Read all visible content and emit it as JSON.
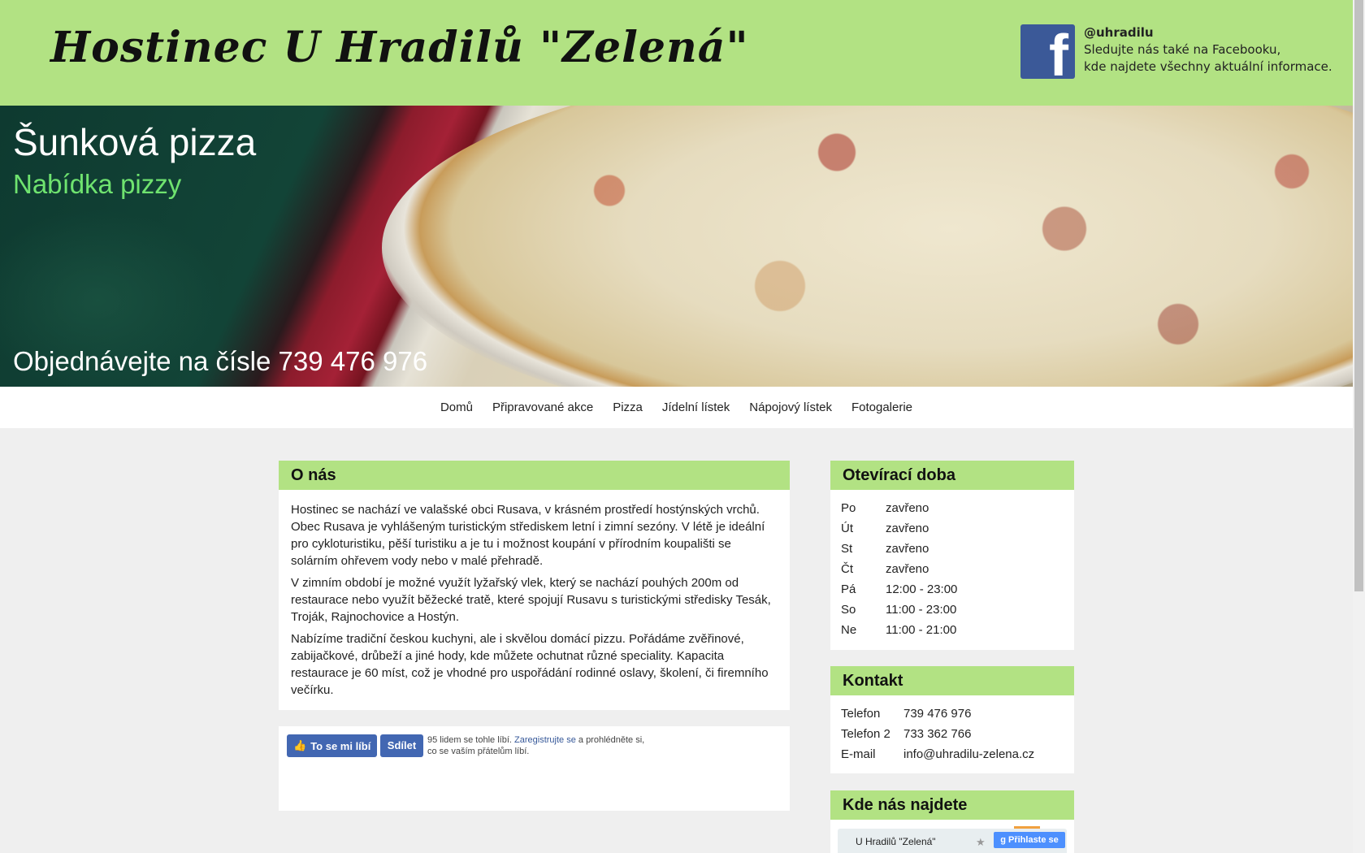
{
  "header": {
    "site_title": "Hostinec U Hradilů \"Zelená\"",
    "fb_handle": "@uhradilu",
    "fb_line1": "Sledujte nás také na Facebooku,",
    "fb_line2": "kde najdete všechny aktuální informace.",
    "fb_icon": "facebook-icon"
  },
  "hero": {
    "title": "Šunková pizza",
    "subtitle": "Nabídka pizzy",
    "order_text": "Objednávejte na čísle 739 476 976"
  },
  "nav": {
    "items": [
      "Domů",
      "Připravované akce",
      "Pizza",
      "Jídelní lístek",
      "Nápojový lístek",
      "Fotogalerie"
    ]
  },
  "about": {
    "title": "O nás",
    "paragraphs": [
      "Hostinec se nachází ve valašské obci Rusava, v krásném prostředí hostýnských vrchů. Obec Rusava je vyhlášeným turistickým střediskem letní i zimní sezóny. V létě je ideální pro cykloturistiku, pěší turistiku a je tu i možnost koupání v přírodním koupališti se solárním ohřevem vody nebo v malé přehradě.",
      "V zimním období je možné využít lyžařský vlek, který se nachází pouhých 200m od restaurace nebo využít běžecké tratě, které spojují Rusavu s turistickými středisky Tesák, Troják, Rajnochovice a Hostýn.",
      "Nabízíme tradiční českou kuchyni, ale i skvělou domácí pizzu. Pořádáme zvěřinové, zabijačkové, drůbeží a jiné hody, kde můžete ochutnat různé speciality. Kapacita restaurace je 60 míst, což je vhodné pro uspořádání rodinné oslavy, školení, či firemního večírku."
    ]
  },
  "facebook_like": {
    "like_label": "To se mi líbí",
    "share_label": "Sdílet",
    "text_before": "95 lidem se tohle líbí.",
    "link": "Zaregistrujte se",
    "text_after": "a prohlédněte si,",
    "line2": "co se vaším přátelům líbí."
  },
  "hours": {
    "title": "Otevírací doba",
    "rows": [
      {
        "day": "Po",
        "time": "zavřeno"
      },
      {
        "day": "Út",
        "time": "zavřeno"
      },
      {
        "day": "St",
        "time": "zavřeno"
      },
      {
        "day": "Čt",
        "time": "zavřeno"
      },
      {
        "day": "Pá",
        "time": "12:00 - 23:00"
      },
      {
        "day": "So",
        "time": "11:00 - 23:00"
      },
      {
        "day": "Ne",
        "time": "11:00 - 21:00"
      }
    ]
  },
  "contact": {
    "title": "Kontakt",
    "rows": [
      {
        "label": "Telefon",
        "value": "739 476 976"
      },
      {
        "label": "Telefon 2",
        "value": "733 362 766"
      },
      {
        "label": "E-mail",
        "value": "info@uhradilu-zelena.cz"
      }
    ]
  },
  "map": {
    "title": "Kde nás najdete",
    "place_label": "U Hradilů \"Zelená\"",
    "signin_label": "Přihlaste se"
  },
  "colors": {
    "accent_green": "#b2e283",
    "hero_subtitle": "#6fe36f",
    "facebook_blue": "#3b5998",
    "like_button": "#4267b2"
  }
}
